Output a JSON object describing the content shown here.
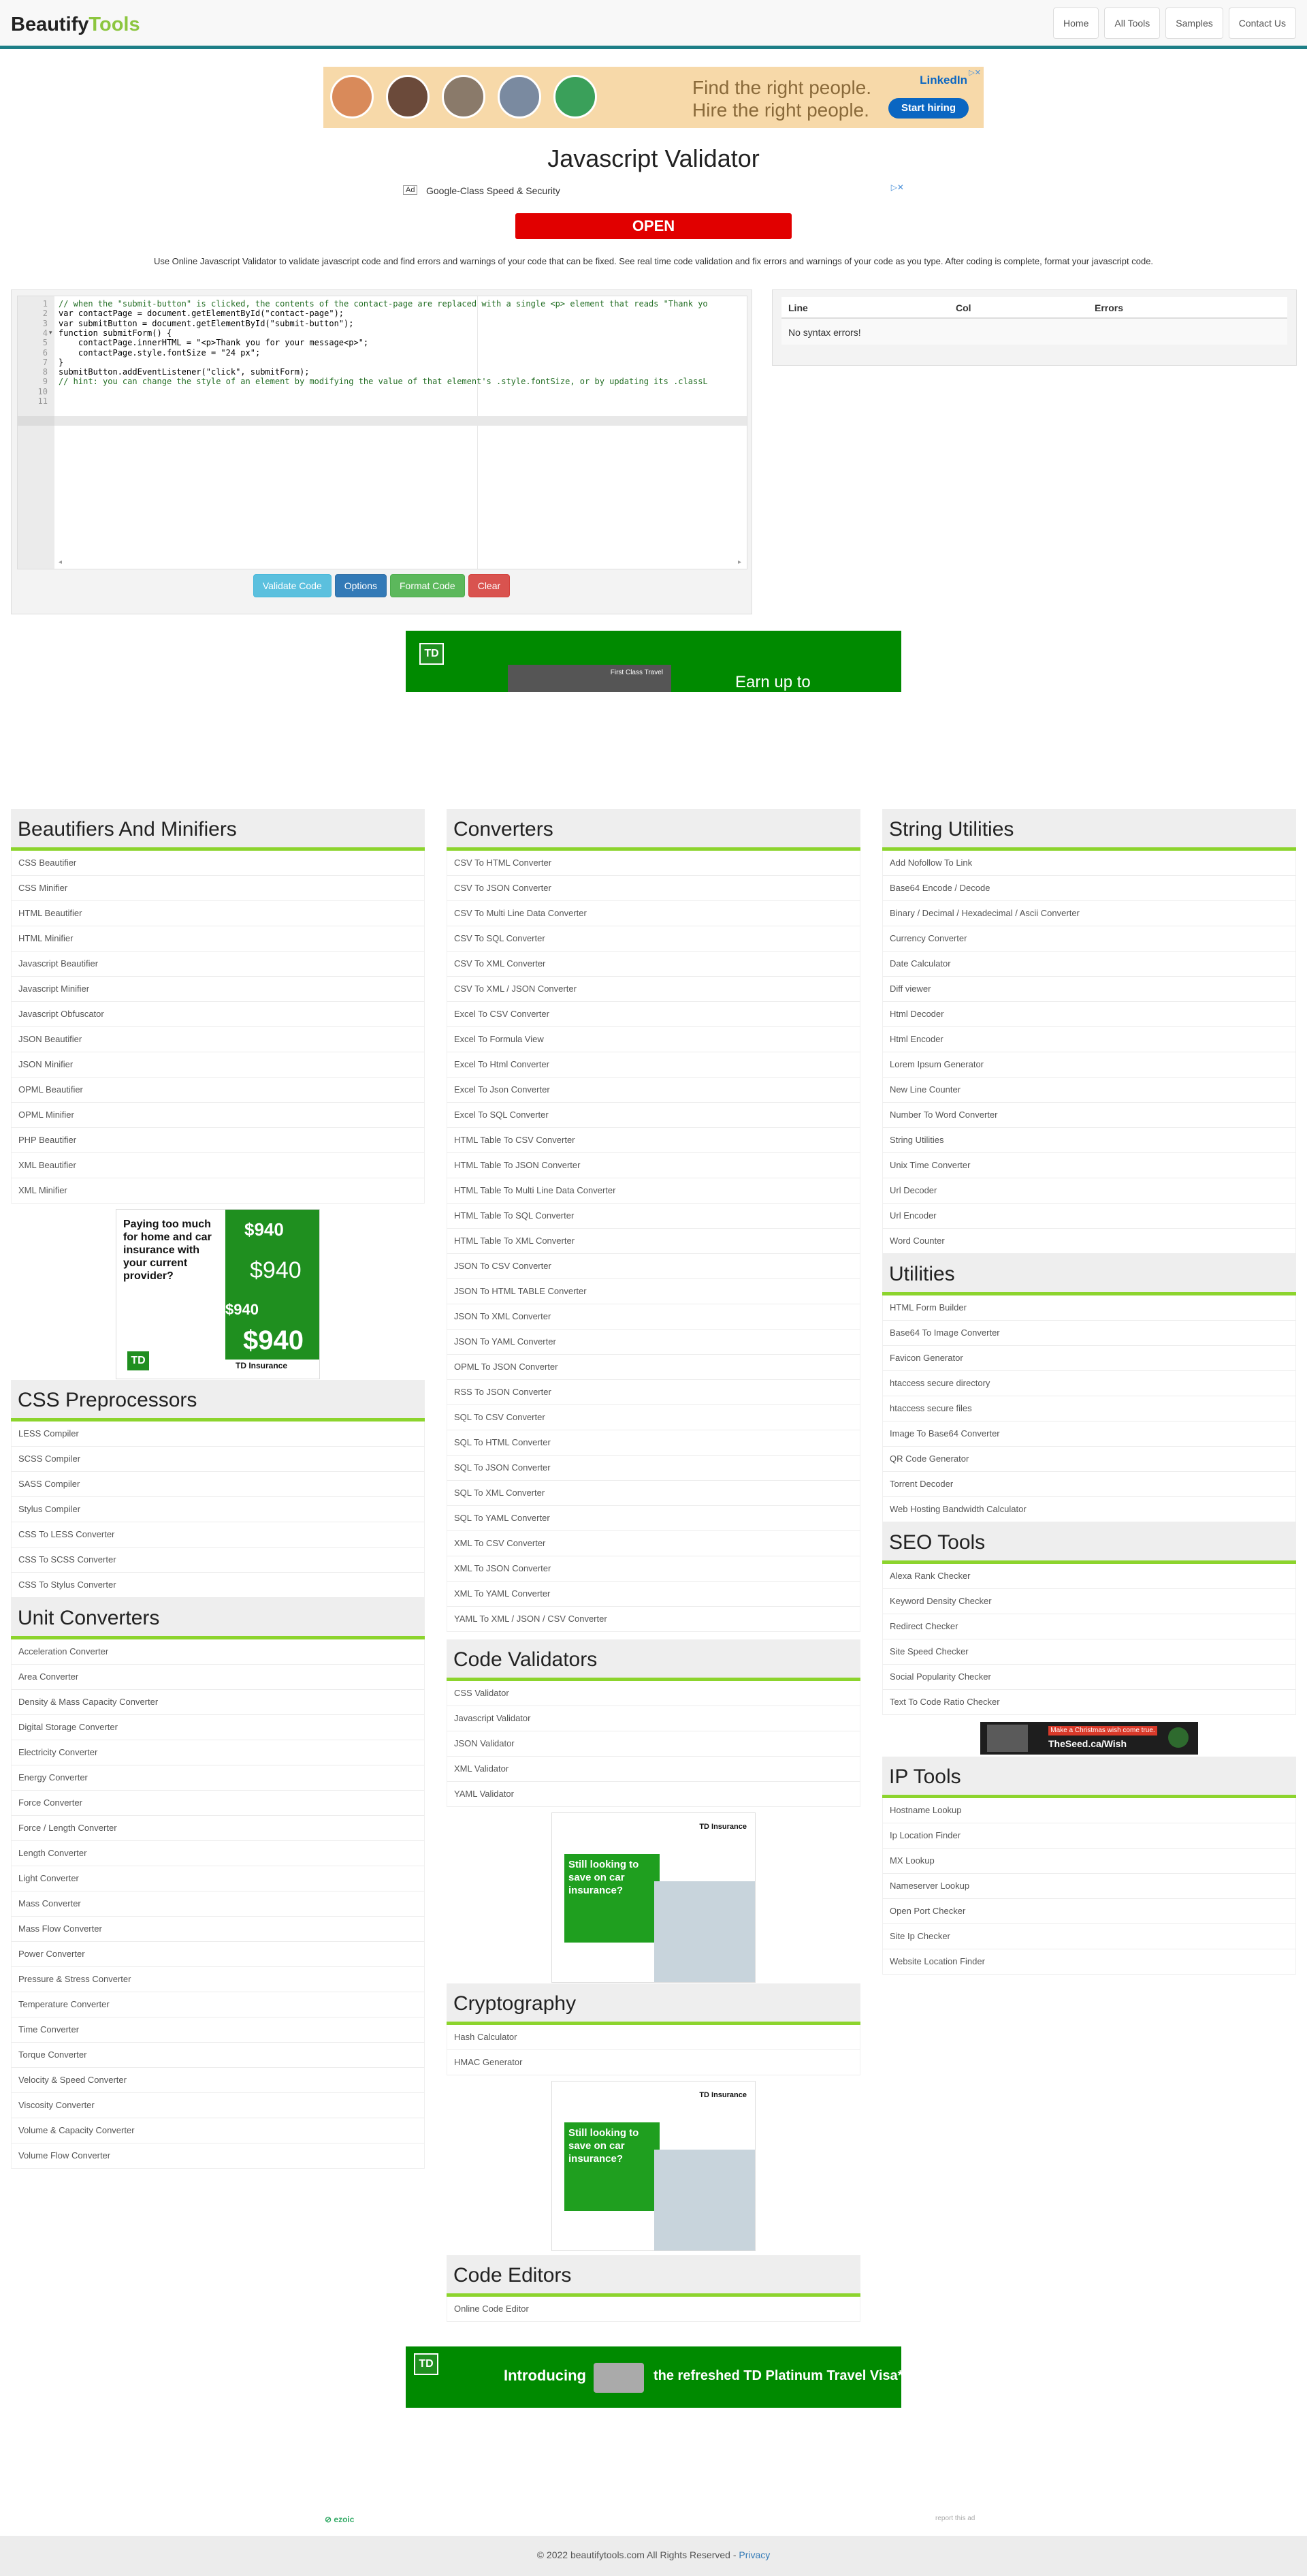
{
  "navbar": {
    "brand_part1": "Beautify",
    "brand_part2": "Tools",
    "links": [
      "Home",
      "All Tools",
      "Samples",
      "Contact Us"
    ]
  },
  "ads": {
    "top_banner": {
      "headline_line1": "Find the right people.",
      "headline_line2": "Hire the right people.",
      "brand": "LinkedIn",
      "cta": "Start hiring"
    },
    "small": {
      "label": "Ad",
      "text": "Google-Class Speed & Security",
      "cta": "OPEN"
    },
    "td_mid": {
      "logo": "TD",
      "card_text": "First Class Travel",
      "text": "Earn up to"
    },
    "td_sidebar": {
      "text": "Paying too much for home and car insurance with your current provider?",
      "amount": "$940",
      "brand": "TD Insurance"
    },
    "td_center": {
      "brand": "TD Insurance",
      "text": "Still looking to save on car insurance?"
    },
    "seed_banner": {
      "line1": "Make a Christmas wish come true.",
      "line2": "TheSeed.ca/Wish"
    },
    "td_bottom": {
      "logo": "TD",
      "text1": "Introducing",
      "text2": "the refreshed TD Platinum Travel Visa* Ca"
    }
  },
  "page": {
    "title": "Javascript Validator",
    "description": "Use Online Javascript Validator to validate javascript code and find errors and warnings of your code that can be fixed. See real time code validation and fix errors and warnings of your code as you type. After coding is complete, format your javascript code."
  },
  "editor": {
    "lines": [
      {
        "n": "1",
        "text": "// when the \"submit-button\" is clicked, the contents of the contact-page are replaced with a single <p> element that reads \"Thank yo",
        "comment": true
      },
      {
        "n": "2",
        "text": "var contactPage = document.getElementById(\"contact-page\");",
        "comment": false
      },
      {
        "n": "3",
        "text": "var submitButton = document.getElementById(\"submit-button\");",
        "comment": false
      },
      {
        "n": "4",
        "text": "function submitForm() {",
        "comment": false
      },
      {
        "n": "5",
        "text": "    contactPage.innerHTML = \"<p>Thank you for your message<p>\";",
        "comment": false
      },
      {
        "n": "6",
        "text": "    contactPage.style.fontSize = \"24 px\";",
        "comment": false
      },
      {
        "n": "7",
        "text": "}",
        "comment": false
      },
      {
        "n": "8",
        "text": "submitButton.addEventListener(\"click\", submitForm);",
        "comment": false
      },
      {
        "n": "9",
        "text": "// hint: you can change the style of an element by modifying the value of that element's .style.fontSize, or by updating its .classL",
        "comment": true
      },
      {
        "n": "10",
        "text": "",
        "comment": false
      },
      {
        "n": "11",
        "text": "",
        "comment": false
      }
    ],
    "buttons": {
      "validate": "Validate Code",
      "options": "Options",
      "format": "Format Code",
      "clear": "Clear"
    }
  },
  "results": {
    "headers": [
      "Line",
      "Col",
      "Errors"
    ],
    "message": "No syntax errors!"
  },
  "sections": {
    "beautifiers": {
      "title": "Beautifiers And Minifiers",
      "items": [
        "CSS Beautifier",
        "CSS Minifier",
        "HTML Beautifier",
        "HTML Minifier",
        "Javascript Beautifier",
        "Javascript Minifier",
        "Javascript Obfuscator",
        "JSON Beautifier",
        "JSON Minifier",
        "OPML Beautifier",
        "OPML Minifier",
        "PHP Beautifier",
        "XML Beautifier",
        "XML Minifier"
      ]
    },
    "css_preprocessors": {
      "title": "CSS Preprocessors",
      "items": [
        "LESS Compiler",
        "SCSS Compiler",
        "SASS Compiler",
        "Stylus Compiler",
        "CSS To LESS Converter",
        "CSS To SCSS Converter",
        "CSS To Stylus Converter"
      ]
    },
    "unit_converters": {
      "title": "Unit Converters",
      "items": [
        "Acceleration Converter",
        "Area Converter",
        "Density & Mass Capacity Converter",
        "Digital Storage Converter",
        "Electricity Converter",
        "Energy Converter",
        "Force Converter",
        "Force / Length Converter",
        "Length Converter",
        "Light Converter",
        "Mass Converter",
        "Mass Flow Converter",
        "Power Converter",
        "Pressure & Stress Converter",
        "Temperature Converter",
        "Time Converter",
        "Torque Converter",
        "Velocity & Speed Converter",
        "Viscosity Converter",
        "Volume & Capacity Converter",
        "Volume Flow Converter"
      ]
    },
    "converters": {
      "title": "Converters",
      "items": [
        "CSV To HTML Converter",
        "CSV To JSON Converter",
        "CSV To Multi Line Data Converter",
        "CSV To SQL Converter",
        "CSV To XML Converter",
        "CSV To XML / JSON Converter",
        "Excel To CSV Converter",
        "Excel To Formula View",
        "Excel To Html Converter",
        "Excel To Json Converter",
        "Excel To SQL Converter",
        "HTML Table To CSV Converter",
        "HTML Table To JSON Converter",
        "HTML Table To Multi Line Data Converter",
        "HTML Table To SQL Converter",
        "HTML Table To XML Converter",
        "JSON To CSV Converter",
        "JSON To HTML TABLE Converter",
        "JSON To XML Converter",
        "JSON To YAML Converter",
        "OPML To JSON Converter",
        "RSS To JSON Converter",
        "SQL To CSV Converter",
        "SQL To HTML Converter",
        "SQL To JSON Converter",
        "SQL To XML Converter",
        "SQL To YAML Converter",
        "XML To CSV Converter",
        "XML To JSON Converter",
        "XML To YAML Converter",
        "YAML To XML / JSON / CSV Converter"
      ]
    },
    "code_validators": {
      "title": "Code Validators",
      "items": [
        "CSS Validator",
        "Javascript Validator",
        "JSON Validator",
        "XML Validator",
        "YAML Validator"
      ]
    },
    "cryptography": {
      "title": "Cryptography",
      "items": [
        "Hash Calculator",
        "HMAC Generator"
      ]
    },
    "code_editors": {
      "title": "Code Editors",
      "items": [
        "Online Code Editor"
      ]
    },
    "string_utilities": {
      "title": "String Utilities",
      "items": [
        "Add Nofollow To Link",
        "Base64 Encode / Decode",
        "Binary / Decimal / Hexadecimal / Ascii Converter",
        "Currency Converter",
        "Date Calculator",
        "Diff viewer",
        "Html Decoder",
        "Html Encoder",
        "Lorem Ipsum Generator",
        "New Line Counter",
        "Number To Word Converter",
        "String Utilities",
        "Unix Time Converter",
        "Url Decoder",
        "Url Encoder",
        "Word Counter"
      ]
    },
    "utilities": {
      "title": "Utilities",
      "items": [
        "HTML Form Builder",
        "Base64 To Image Converter",
        "Favicon Generator",
        "htaccess secure directory",
        "htaccess secure files",
        "Image To Base64 Converter",
        "QR Code Generator",
        "Torrent Decoder",
        "Web Hosting Bandwidth Calculator"
      ]
    },
    "seo_tools": {
      "title": "SEO Tools",
      "items": [
        "Alexa Rank Checker",
        "Keyword Density Checker",
        "Redirect Checker",
        "Site Speed Checker",
        "Social Popularity Checker",
        "Text To Code Ratio Checker"
      ]
    },
    "ip_tools": {
      "title": "IP Tools",
      "items": [
        "Hostname Lookup",
        "Ip Location Finder",
        "MX Lookup",
        "Nameserver Lookup",
        "Open Port Checker",
        "Site Ip Checker",
        "Website Location Finder"
      ]
    }
  },
  "footer": {
    "ezoic": "ezoic",
    "report_ad": "report this ad",
    "copyright": "© 2022 beautifytools.com All Rights Reserved - ",
    "privacy": "Privacy"
  },
  "colors": {
    "nav_border": "#1e7f87",
    "brand_accent": "#8cc63f",
    "section_underline": "#8cd42d",
    "td_green": "#008a00"
  }
}
